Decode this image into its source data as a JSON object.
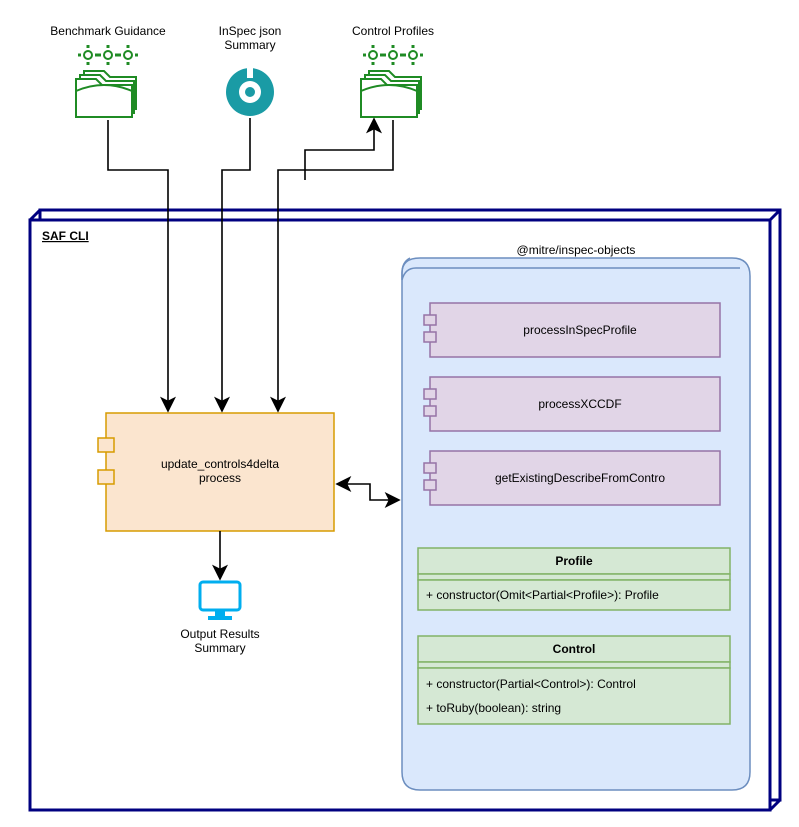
{
  "top": {
    "benchmark": "Benchmark Guidance",
    "inspec_line1": "InSpec json",
    "inspec_line2": "Summary",
    "control_profiles": "Control Profiles"
  },
  "container": {
    "title": "SAF CLI"
  },
  "process": {
    "line1": "update_controls4delta",
    "line2": "process"
  },
  "output": {
    "line1": "Output Results",
    "line2": "Summary"
  },
  "package": {
    "title": "@mitre/inspec-objects",
    "comp1": "processInSpecProfile",
    "comp2": "processXCCDF",
    "comp3": "getExistingDescribeFromContro"
  },
  "profile_class": {
    "name": "Profile",
    "ctor": "+ constructor(Omit<Partial<Profile>): Profile"
  },
  "control_class": {
    "name": "Control",
    "ctor": "+ constructor(Partial<Control>): Control",
    "m1": "+ toRuby(boolean): string"
  },
  "colors": {
    "green": "#1F8B24",
    "teal": "#1A9BA5",
    "orange_fill": "#FBE5CF",
    "orange_stroke": "#D79B00",
    "blue_accent": "#00AEEF",
    "navy": "#000080",
    "pkg_fill": "#DAE8FC",
    "pkg_stroke": "#6C8EBF",
    "comp_fill": "#E1D5E7",
    "comp_stroke": "#9673A6",
    "class_fill": "#D5E8D4",
    "class_stroke": "#82B366"
  }
}
